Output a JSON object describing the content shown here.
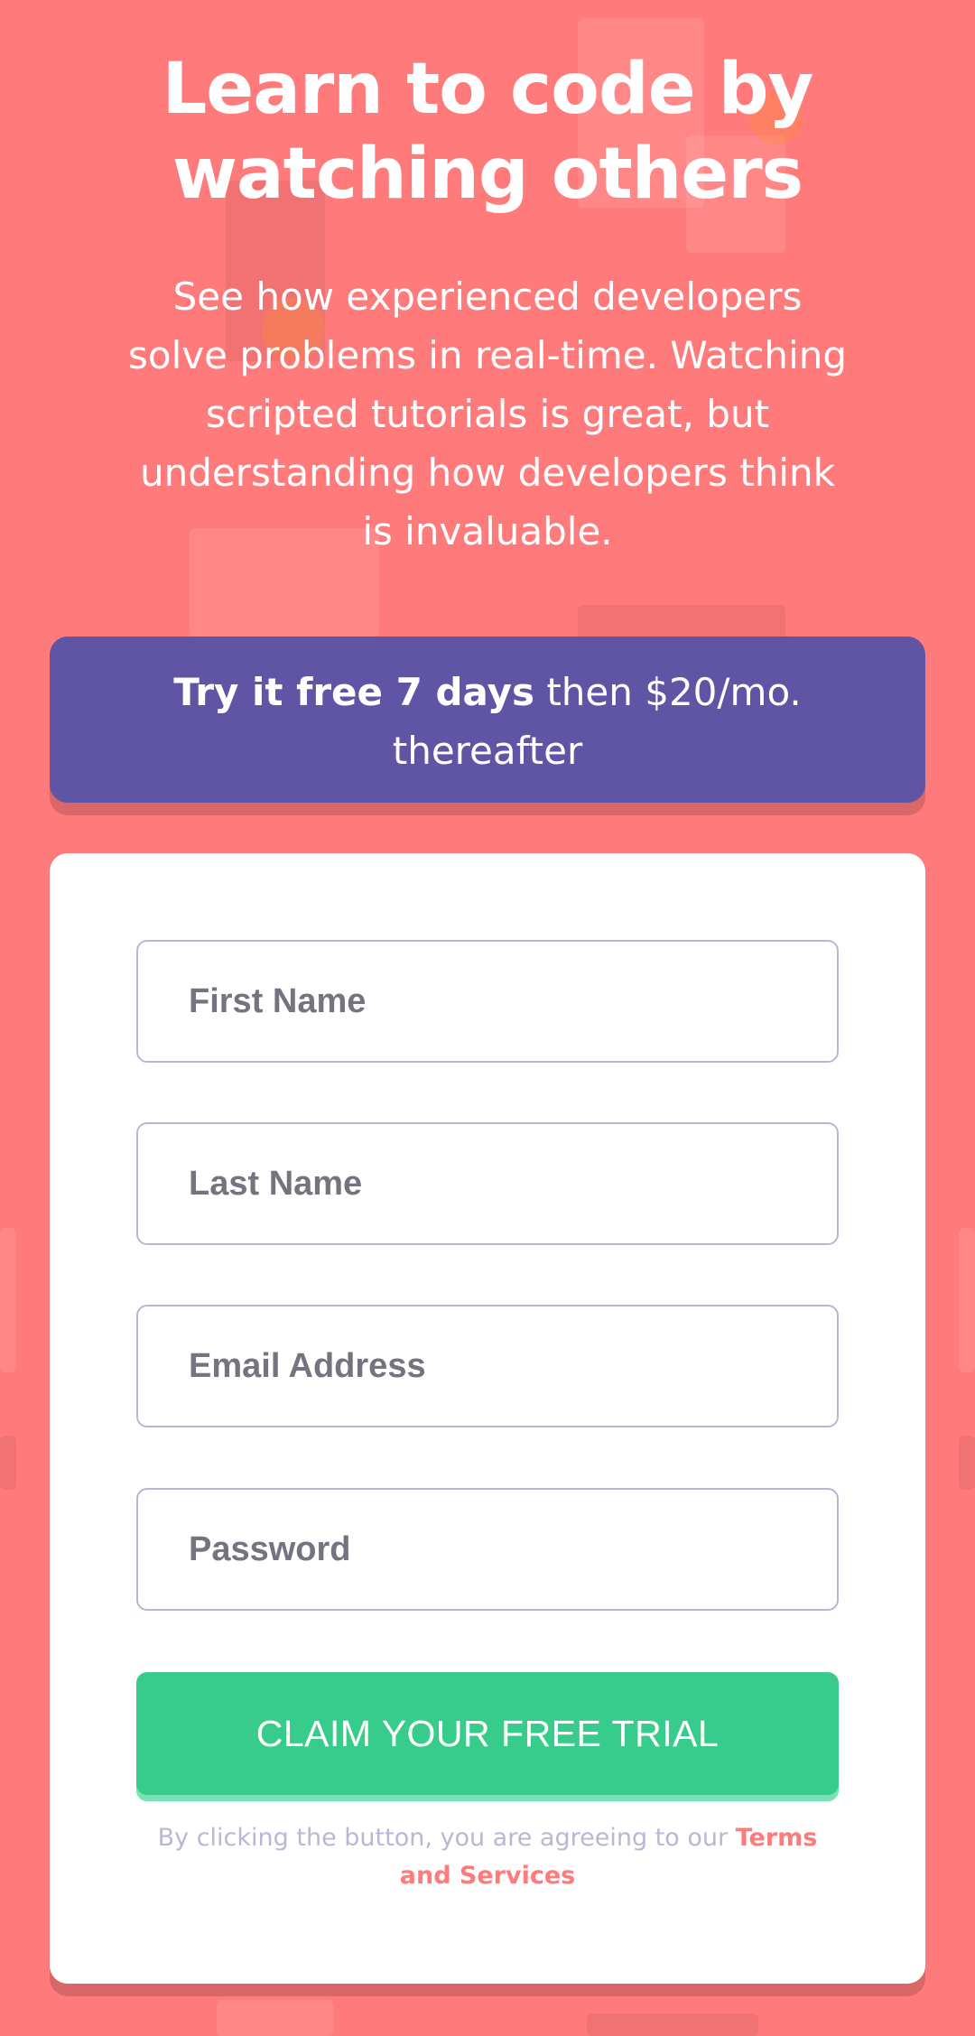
{
  "hero": {
    "title": "Learn to code by watching others",
    "description": "See how experienced developers solve problems in real-time. Watching scripted tutorials is great, but understanding how developers think is invaluable."
  },
  "offer": {
    "strong_text": "Try it free 7 days",
    "rest_text": " then $20/mo. thereafter"
  },
  "form": {
    "first_name_placeholder": "First Name",
    "last_name_placeholder": "Last Name",
    "email_placeholder": "Email Address",
    "password_placeholder": "Password",
    "submit_label": "CLAIM YOUR FREE TRIAL",
    "terms_prefix": "By clicking the button, you are agreeing to our ",
    "terms_link": "Terms and Services"
  },
  "colors": {
    "background": "#FF7A7A",
    "banner": "#6055A5",
    "button": "#38CC8C",
    "card": "#FFFFFF"
  }
}
